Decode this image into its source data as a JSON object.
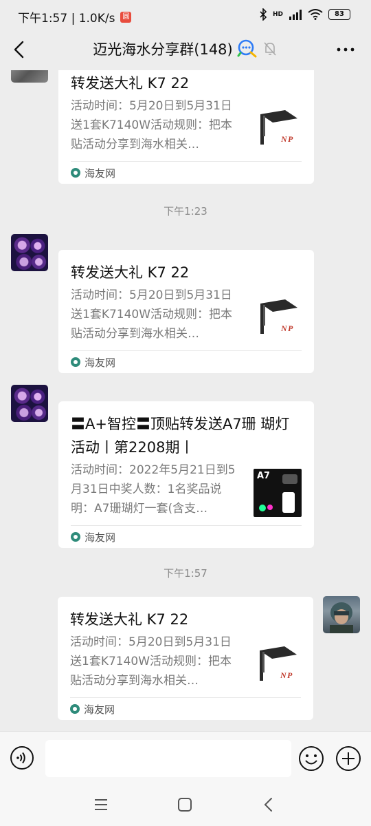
{
  "status_bar": {
    "time_speed": "下午1:57 | 1.0K/s",
    "badge": "圆",
    "network": "HD",
    "battery": "83"
  },
  "header": {
    "title": "迈光海水分享群(148)"
  },
  "messages": [
    {
      "card_title": "转发送大礼 K7 22",
      "card_desc": "活动时间：5月20日到5月31日送1套K7140W活动规则：把本贴活动分享到海水相关…",
      "source": "海友网"
    },
    {
      "timestamp": "下午1:23",
      "card_title": "转发送大礼 K7 22",
      "card_desc": "活动时间：5月20日到5月31日送1套K7140W活动规则：把本贴活动分享到海水相关…",
      "source": "海友网"
    },
    {
      "card_title": "〓A+智控〓顶贴转发送A7珊 瑚灯活动丨第2208期丨",
      "card_desc": "活动时间：2022年5月21日到5月31日中奖人数：1名奖品说明：A7珊瑚灯一套(含支…",
      "source": "海友网",
      "thumb_label": "A7"
    },
    {
      "timestamp": "下午1:57",
      "card_title": "转发送大礼 K7 22",
      "card_desc": "活动时间：5月20日到5月31日送1套K7140W活动规则：把本贴活动分享到海水相关…",
      "source": "海友网"
    }
  ],
  "input": {
    "placeholder": ""
  },
  "icons": {
    "back": "back-arrow-icon",
    "chat_logo": "chat-bubble-icon",
    "mute": "bell-muted-icon",
    "more": "more-dots-icon",
    "voice": "voice-icon",
    "emoji": "emoji-icon",
    "plus": "plus-icon",
    "nav_menu": "menu-icon",
    "nav_home": "home-icon",
    "nav_back": "nav-back-icon"
  }
}
